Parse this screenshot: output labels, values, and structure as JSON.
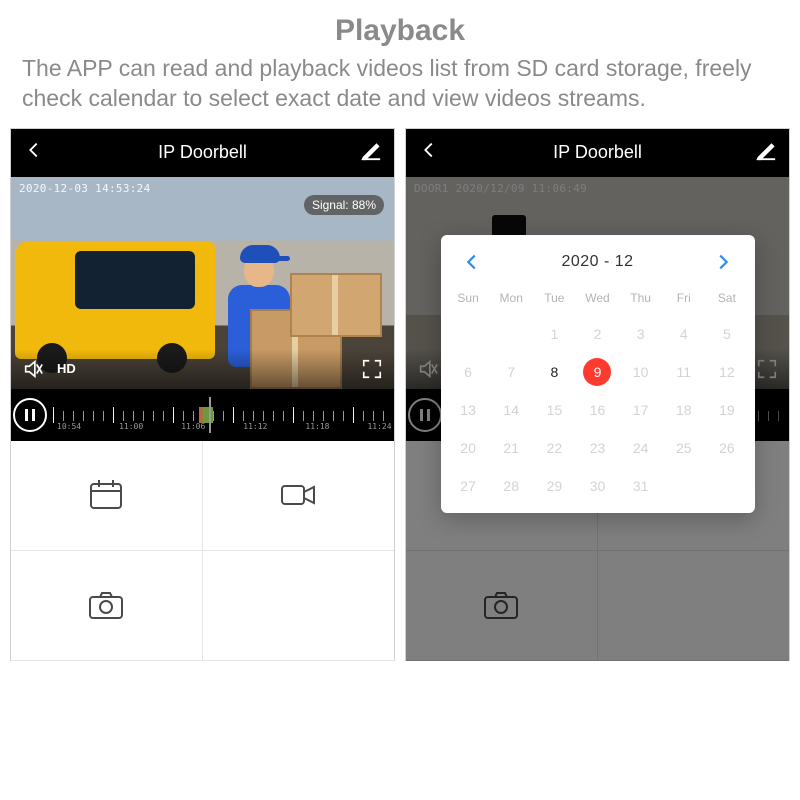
{
  "page": {
    "title": "Playback",
    "description": "The APP can read and playback videos list from SD card storage, freely check calendar to select exact date and view videos streams."
  },
  "left": {
    "header_title": "IP Doorbell",
    "timestamp_overlay": "2020-12-03  14:53:24",
    "signal_label": "Signal: 88%",
    "hd_label": "HD",
    "timeline_ticks": [
      "10:54",
      "11:00",
      "11:06",
      "11:12",
      "11:18",
      "11:24"
    ]
  },
  "right": {
    "header_title": "IP Doorbell",
    "timestamp_overlay": "DOOR1 2020/12/09  11:06:49",
    "calendar": {
      "month_label": "2020 - 12",
      "daynames": [
        "Sun",
        "Mon",
        "Tue",
        "Wed",
        "Thu",
        "Fri",
        "Sat"
      ],
      "weeks": [
        [
          null,
          null,
          1,
          2,
          3,
          4,
          5
        ],
        [
          6,
          7,
          8,
          9,
          10,
          11,
          12
        ],
        [
          13,
          14,
          15,
          16,
          17,
          18,
          19
        ],
        [
          20,
          21,
          22,
          23,
          24,
          25,
          26
        ],
        [
          27,
          28,
          29,
          30,
          31,
          null,
          null
        ]
      ],
      "has_data_days": [
        8
      ],
      "selected_day": 9
    }
  },
  "colors": {
    "accent_red": "#ff3b30",
    "accent_blue": "#2a8df4",
    "text_muted": "#8a8a8a"
  }
}
